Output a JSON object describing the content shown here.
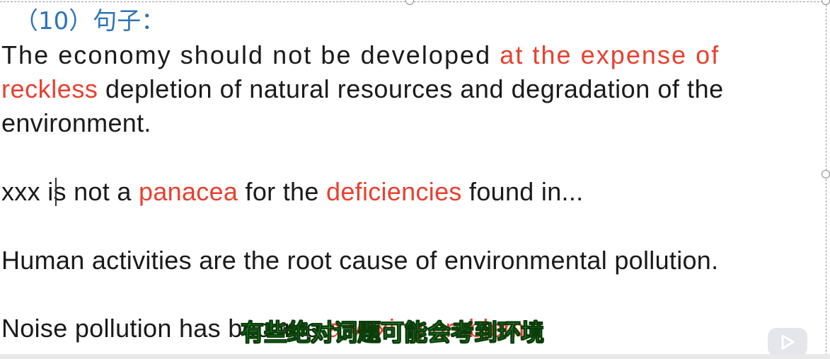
{
  "slide": {
    "heading": "（10）句子：",
    "line1": {
      "black": "The economy should not be developed ",
      "red": "at the expense of"
    },
    "line2": {
      "red": "reckless",
      "black": " depletion of natural resources and degradation of the"
    },
    "line3": {
      "black": "environment."
    },
    "line4": {
      "a": "xxx ",
      "b": "is",
      "c": " not a ",
      "d": "panacea",
      "e": " for the ",
      "f": "deficiencies",
      "g": " found in..."
    },
    "line5": {
      "black": "Human activities are the root cause of environmental pollution."
    },
    "line6": {
      "black": "Noise pollution has become",
      "red": "a vexing problem."
    }
  },
  "subtitle": "有些绝对词题可能会考到环境",
  "colors": {
    "heading": "#2e75b6",
    "text": "#1a1a1a",
    "highlight": "#e8402f",
    "subtitle": "#3fd14a"
  },
  "icons": [
    "play-logo-icon"
  ]
}
